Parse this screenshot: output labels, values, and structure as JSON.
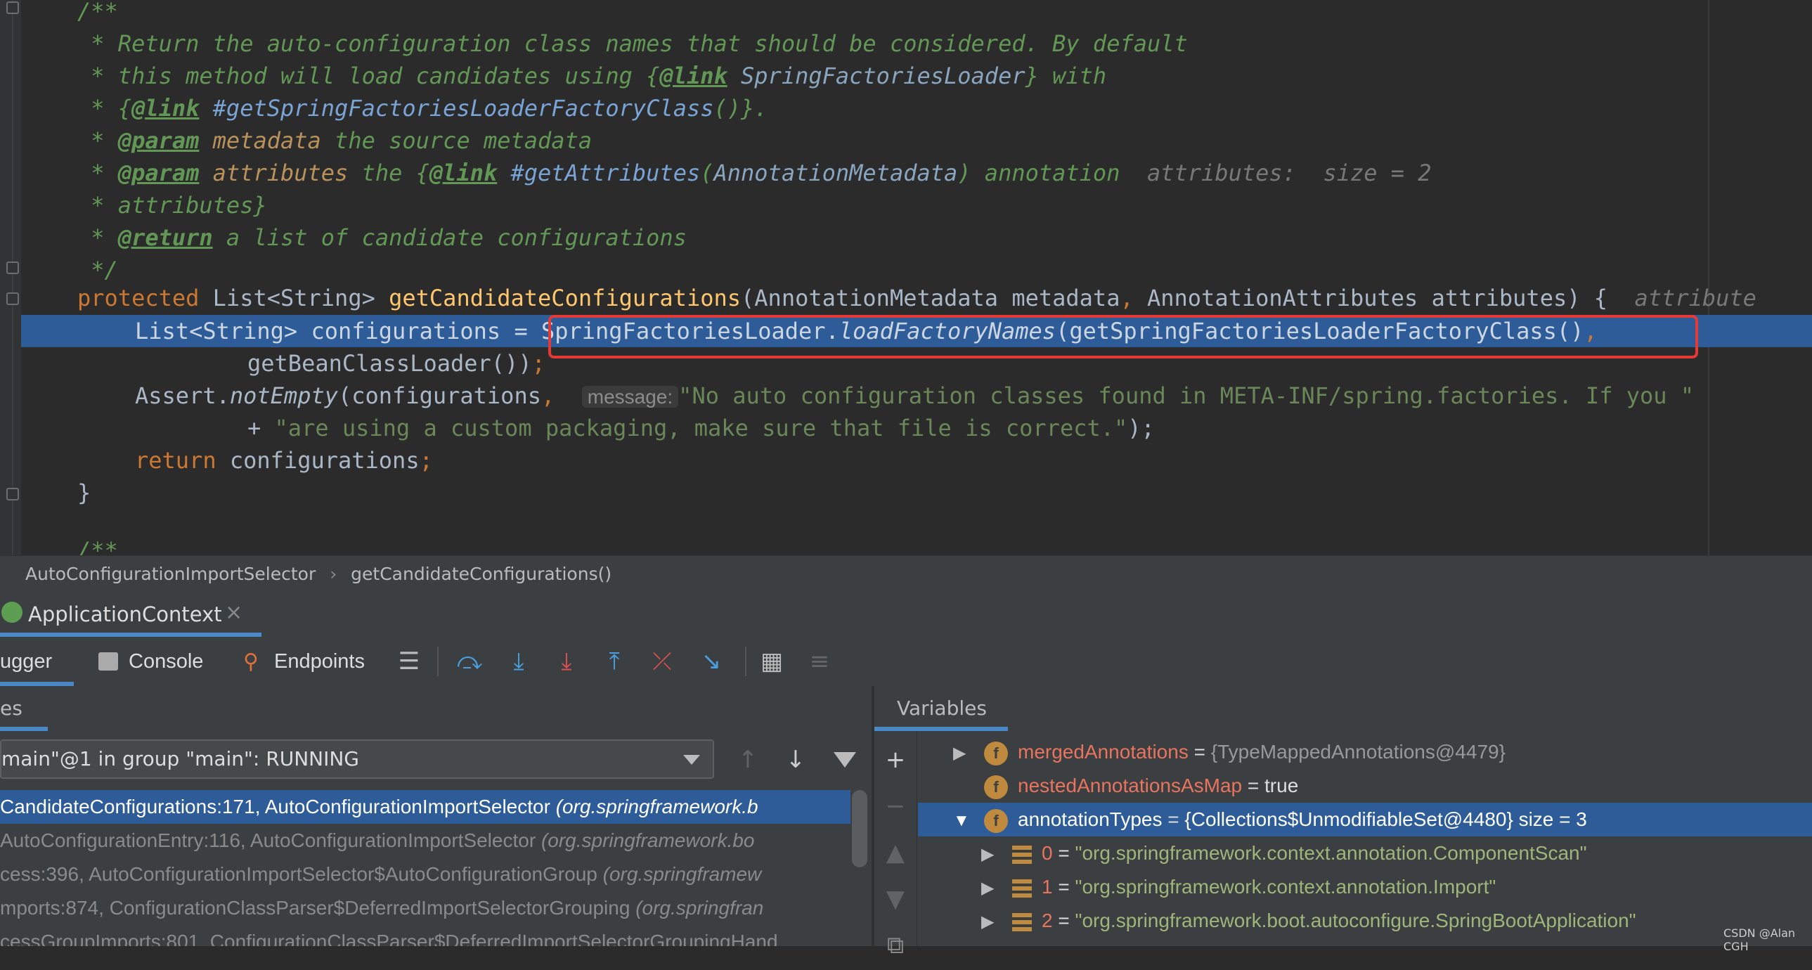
{
  "editor": {
    "doc_lines": [
      {
        "prefix": "/**",
        "parts": []
      },
      {
        "prefix": " * ",
        "parts": [
          {
            "t": "Return the auto-configuration class names that should be considered. By default",
            "c": "doc"
          }
        ]
      },
      {
        "prefix": " * ",
        "parts": [
          {
            "t": "this method will load candidates using ",
            "c": "doc"
          },
          {
            "t": "{",
            "c": "doc"
          },
          {
            "t": "@link",
            "c": "tag"
          },
          {
            "t": " SpringFactoriesLoader",
            "c": "refplain"
          },
          {
            "t": "} with",
            "c": "doc"
          }
        ]
      },
      {
        "prefix": " * ",
        "parts": [
          {
            "t": "{",
            "c": "doc"
          },
          {
            "t": "@link",
            "c": "tag"
          },
          {
            "t": " #getSpringFactoriesLoaderFactoryClass",
            "c": "ref"
          },
          {
            "t": "()}.",
            "c": "doc"
          }
        ]
      },
      {
        "prefix": " * ",
        "parts": [
          {
            "t": "@param",
            "c": "tag"
          },
          {
            "t": " metadata",
            "c": "pname"
          },
          {
            "t": " the source metadata",
            "c": "doc"
          }
        ]
      },
      {
        "prefix": " * ",
        "parts": [
          {
            "t": "@param",
            "c": "tag"
          },
          {
            "t": " attributes",
            "c": "pname"
          },
          {
            "t": " the ",
            "c": "doc"
          },
          {
            "t": "{",
            "c": "doc"
          },
          {
            "t": "@link",
            "c": "tag"
          },
          {
            "t": " #getAttributes",
            "c": "ref"
          },
          {
            "t": "(",
            "c": "doc"
          },
          {
            "t": "AnnotationMetadata",
            "c": "refplain"
          },
          {
            "t": ") annotation  ",
            "c": "doc"
          },
          {
            "t": "attributes:  size = 2",
            "c": "hint"
          }
        ]
      },
      {
        "prefix": " * ",
        "parts": [
          {
            "t": "attributes}",
            "c": "doc"
          }
        ]
      },
      {
        "prefix": " * ",
        "parts": [
          {
            "t": "@return",
            "c": "tag"
          },
          {
            "t": " a list of candidate configurations",
            "c": "doc"
          }
        ]
      },
      {
        "prefix": " */",
        "parts": []
      }
    ],
    "signature": {
      "kw": "protected ",
      "type": "List<String> ",
      "name": "getCandidateConfigurations",
      "params": "(AnnotationMetadata metadata",
      "comma": ",",
      "params2": " AnnotationAttributes attributes) {",
      "hint": "  attribute"
    },
    "exec_line": {
      "lhs": "List<String> configurations = ",
      "cls": "SpringFactoriesLoader.",
      "call": "loadFactoryNames",
      "rest": "(getSpringFactoriesLoaderFactoryClass()",
      "comma": ","
    },
    "line_cont": {
      "text": "getBeanClassLoader()",
      "end": ")",
      "semi": ";"
    },
    "assert_line": {
      "cls": "Assert.",
      "call": "notEmpty",
      "open": "(configurations",
      "comma": ",",
      "hint": "message:",
      "str": "\"No auto configuration classes found in META-INF/spring.factories. If you \""
    },
    "assert_cont": {
      "plus": "+ ",
      "str": "\"are using a custom packaging, make sure that file is correct.\"",
      "end": ");"
    },
    "return_line": {
      "kw": "return",
      "rest": " configurations",
      "semi": ";"
    },
    "close_brace": "}",
    "next_doc": "/**"
  },
  "breadcrumb": {
    "items": [
      "AutoConfigurationImportSelector",
      "getCandidateConfigurations()"
    ],
    "sep": "›"
  },
  "run_tab": {
    "label": "ApplicationContext",
    "close": "×"
  },
  "toolbar": {
    "tabs": [
      {
        "label": "ugger"
      },
      {
        "label": "Console",
        "icon": "console-icon"
      },
      {
        "label": "Endpoints",
        "icon": "endpoints-icon"
      }
    ]
  },
  "frames": {
    "title": "es",
    "thread": "main\"@1 in group \"main\": RUNNING",
    "items": [
      {
        "text": "CandidateConfigurations:171, AutoConfigurationImportSelector ",
        "pkg": "(org.springframework.b",
        "selected": true
      },
      {
        "text": "AutoConfigurationEntry:116, AutoConfigurationImportSelector ",
        "pkg": "(org.springframework.bo",
        "selected": false
      },
      {
        "text": "cess:396, AutoConfigurationImportSelector$AutoConfigurationGroup ",
        "pkg": "(org.springframew",
        "selected": false
      },
      {
        "text": "mports:874, ConfigurationClassParser$DeferredImportSelectorGrouping ",
        "pkg": "(org.springfran",
        "selected": false
      },
      {
        "text": "cessGroupImports:801, ConfigurationClassParser$DeferredImportSelectorGroupingHand",
        "pkg": "",
        "selected": false
      }
    ]
  },
  "variables": {
    "title": "Variables",
    "items": [
      {
        "name": "mergedAnnotations",
        "eq": " = ",
        "value": "{TypeMappedAnnotations@4479}",
        "badge": "f"
      },
      {
        "name": "nestedAnnotationsAsMap",
        "eq": " = ",
        "value": "true",
        "badge": "f"
      },
      {
        "name": "annotationTypes",
        "eq": " = ",
        "value": "{Collections$UnmodifiableSet@4480}  size = 3",
        "badge": "f"
      },
      {
        "name": "0",
        "eq": " = ",
        "value": "\"org.springframework.context.annotation.ComponentScan\""
      },
      {
        "name": "1",
        "eq": " = ",
        "value": "\"org.springframework.context.annotation.Import\""
      },
      {
        "name": "2",
        "eq": " = ",
        "value": "\"org.springframework.boot.autoconfigure.SpringBootApplication\""
      }
    ]
  },
  "watermark": "CSDN @Alan CGH",
  "colors": {
    "accent": "#4a88c7",
    "selection": "#2d5c99",
    "highlight_box": "#e53935"
  }
}
